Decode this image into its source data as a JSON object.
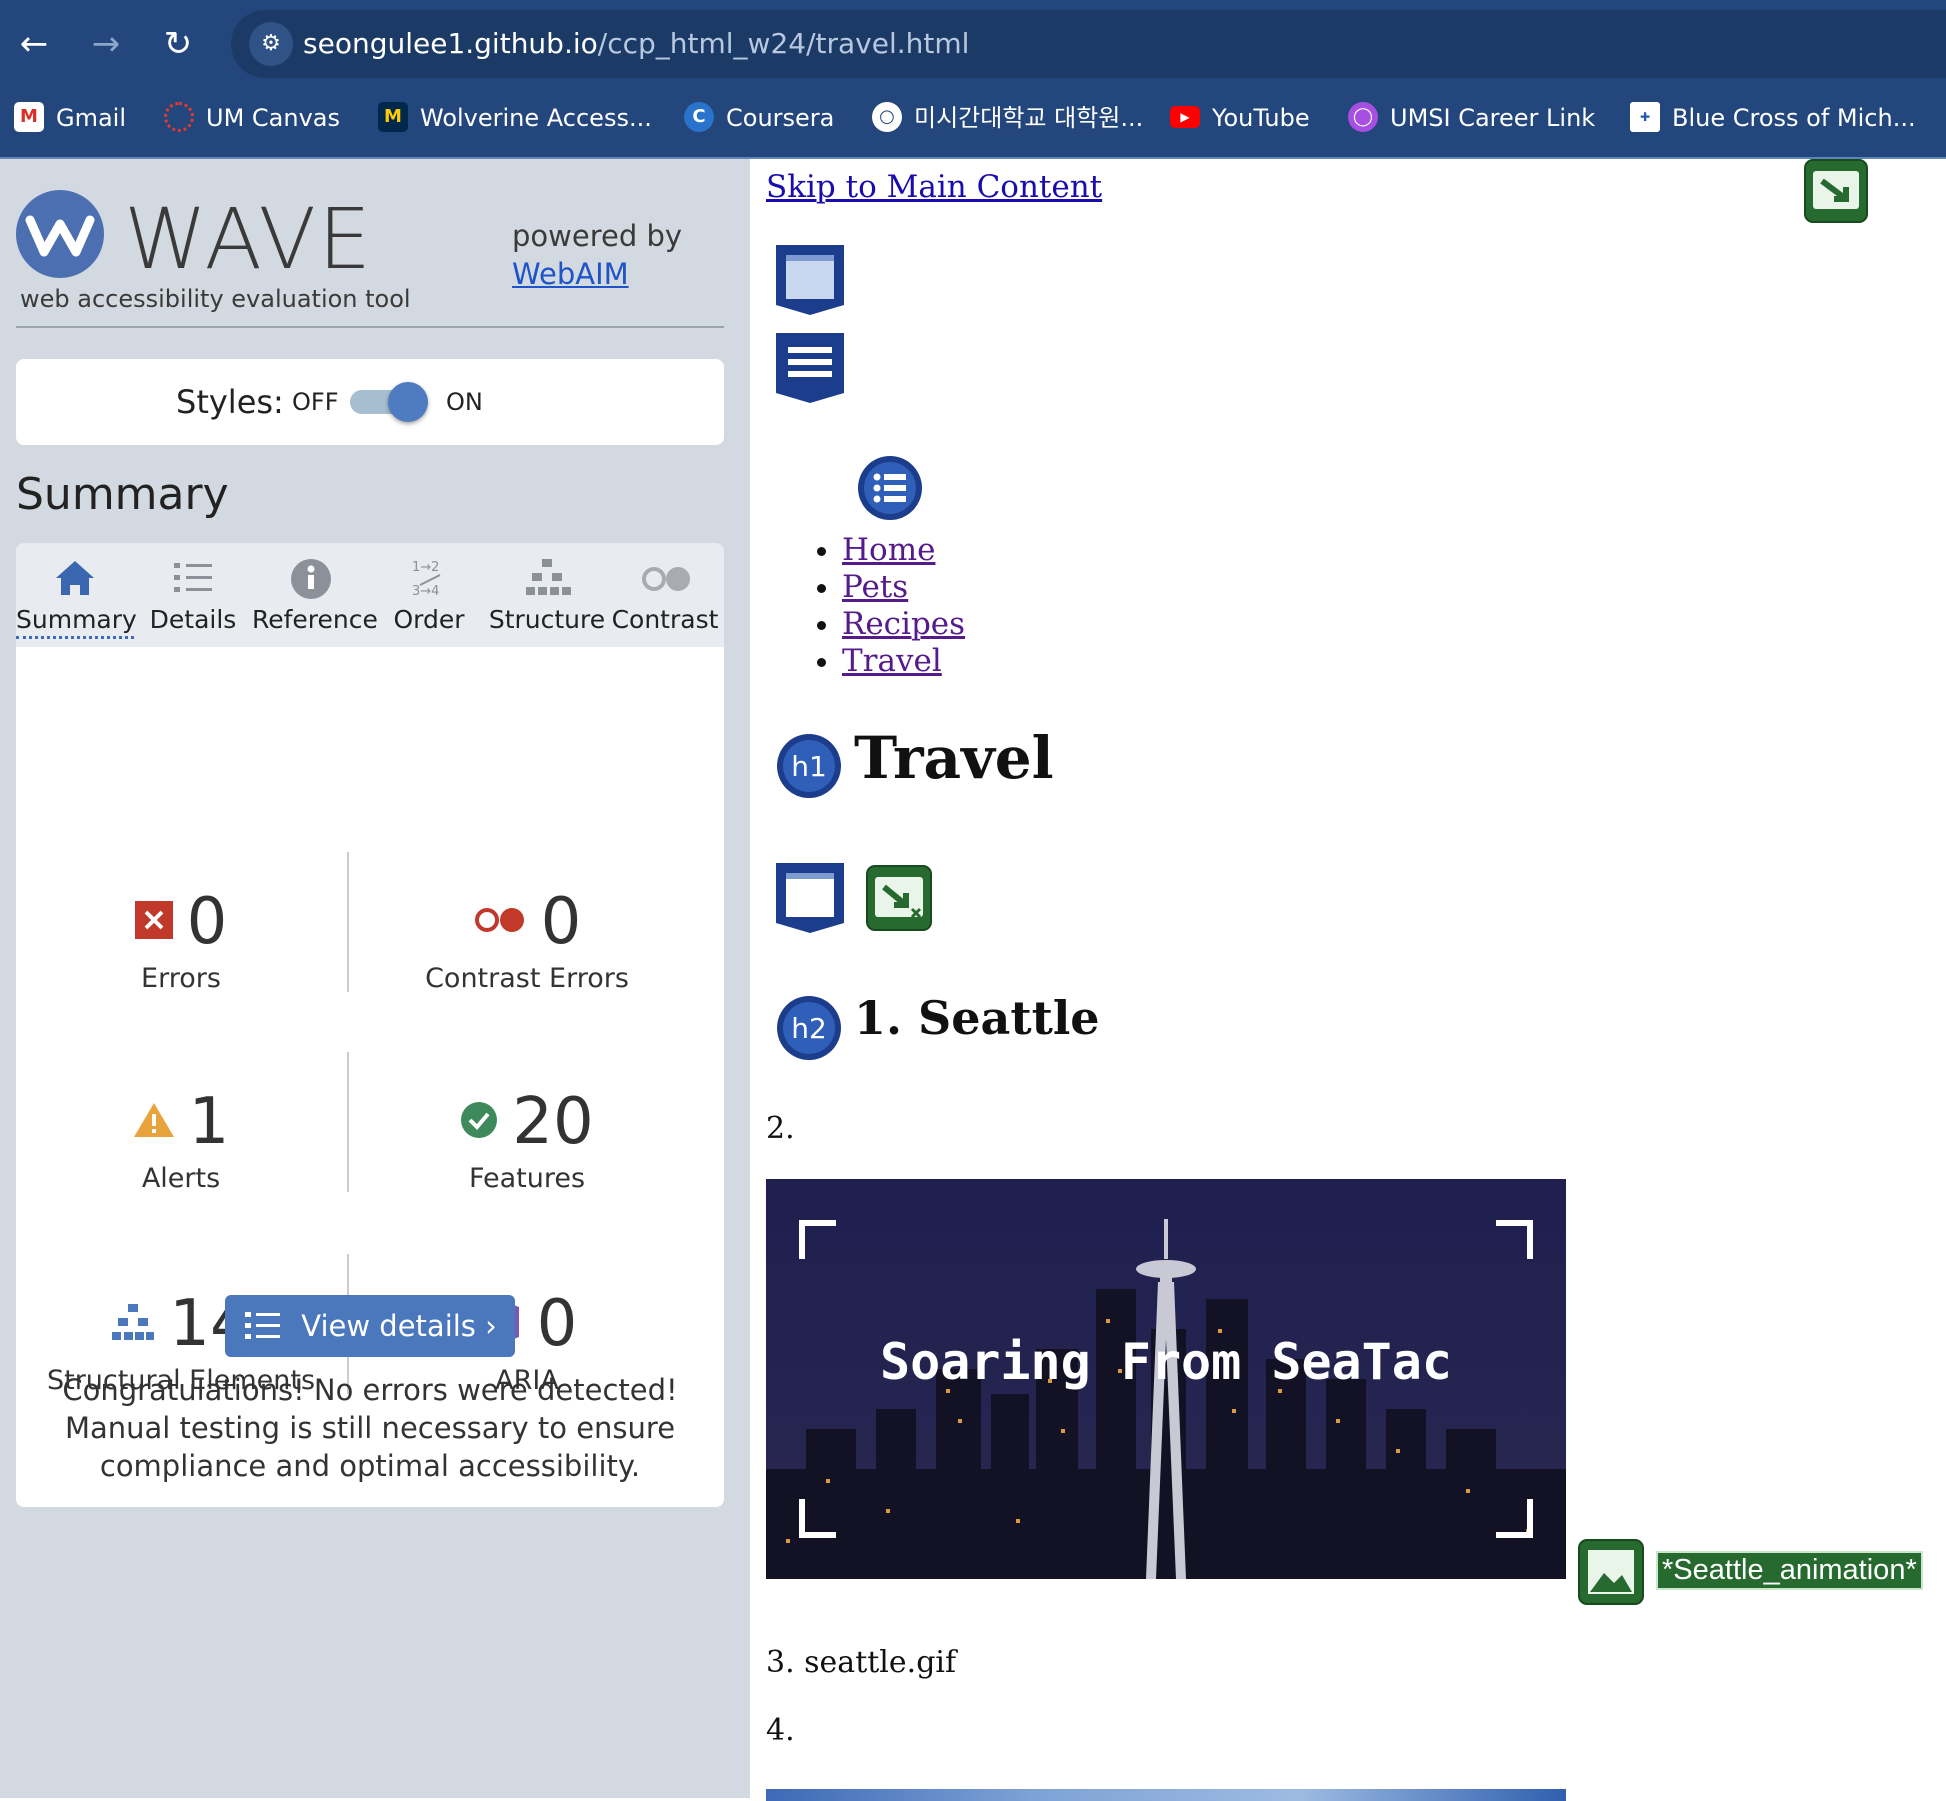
{
  "browser": {
    "url_domain": "seongulee1.github.io",
    "url_path": "/ccp_html_w24/travel.html",
    "bookmarks": [
      {
        "label": "Gmail",
        "icon": "gmail-icon"
      },
      {
        "label": "UM Canvas",
        "icon": "canvas-icon"
      },
      {
        "label": "Wolverine Access...",
        "icon": "michigan-m-icon"
      },
      {
        "label": "Coursera",
        "icon": "coursera-icon"
      },
      {
        "label": "미시간대학교 대학원...",
        "icon": "globe-icon"
      },
      {
        "label": "YouTube",
        "icon": "youtube-icon"
      },
      {
        "label": "UMSI Career Link",
        "icon": "umsi-icon"
      },
      {
        "label": "Blue Cross of Mich...",
        "icon": "bluecross-icon"
      }
    ]
  },
  "wave": {
    "logo_text": "WAVE",
    "tagline": "web accessibility evaluation tool",
    "powered_by": "powered by",
    "webaim_link": "WebAIM",
    "styles_label": "Styles:",
    "styles_off": "OFF",
    "styles_on": "ON",
    "styles_enabled": true,
    "summary_heading": "Summary",
    "tabs": [
      {
        "label": "Summary",
        "icon": "home-icon",
        "active": true
      },
      {
        "label": "Details",
        "icon": "list-icon",
        "active": false
      },
      {
        "label": "Reference",
        "icon": "info-icon",
        "active": false
      },
      {
        "label": "Order",
        "icon": "order-icon",
        "active": false
      },
      {
        "label": "Structure",
        "icon": "structure-icon",
        "active": false
      },
      {
        "label": "Contrast",
        "icon": "contrast-icon",
        "active": false
      }
    ],
    "stats": {
      "errors": {
        "value": "0",
        "label": "Errors",
        "color": "#c0392b"
      },
      "contrast_errors": {
        "value": "0",
        "label": "Contrast Errors",
        "color": "#c0392b"
      },
      "alerts": {
        "value": "1",
        "label": "Alerts",
        "color": "#e8a33d"
      },
      "features": {
        "value": "20",
        "label": "Features",
        "color": "#3f8a5c"
      },
      "structural": {
        "value": "14",
        "label": "Structural Elements",
        "color": "#4b77bd"
      },
      "aria": {
        "value": "0",
        "label": "ARIA",
        "color": "#5b3b8c"
      }
    },
    "view_details": "View details ›",
    "congrats": "Congratulations! No errors were detected! Manual testing is still necessary to ensure compliance and optimal accessibility."
  },
  "page": {
    "skip_link": "Skip to Main Content",
    "nav": [
      "Home",
      "Pets",
      "Recipes",
      "Travel"
    ],
    "h1_badge": "h1",
    "h1": "Travel",
    "h2_badge": "h2",
    "h2": "1. Seattle",
    "item2": "2.",
    "banner_text": "Soaring From SeaTac",
    "alt_text": "*Seattle_animation*",
    "item3": "3. seattle.gif",
    "item4": "4."
  }
}
